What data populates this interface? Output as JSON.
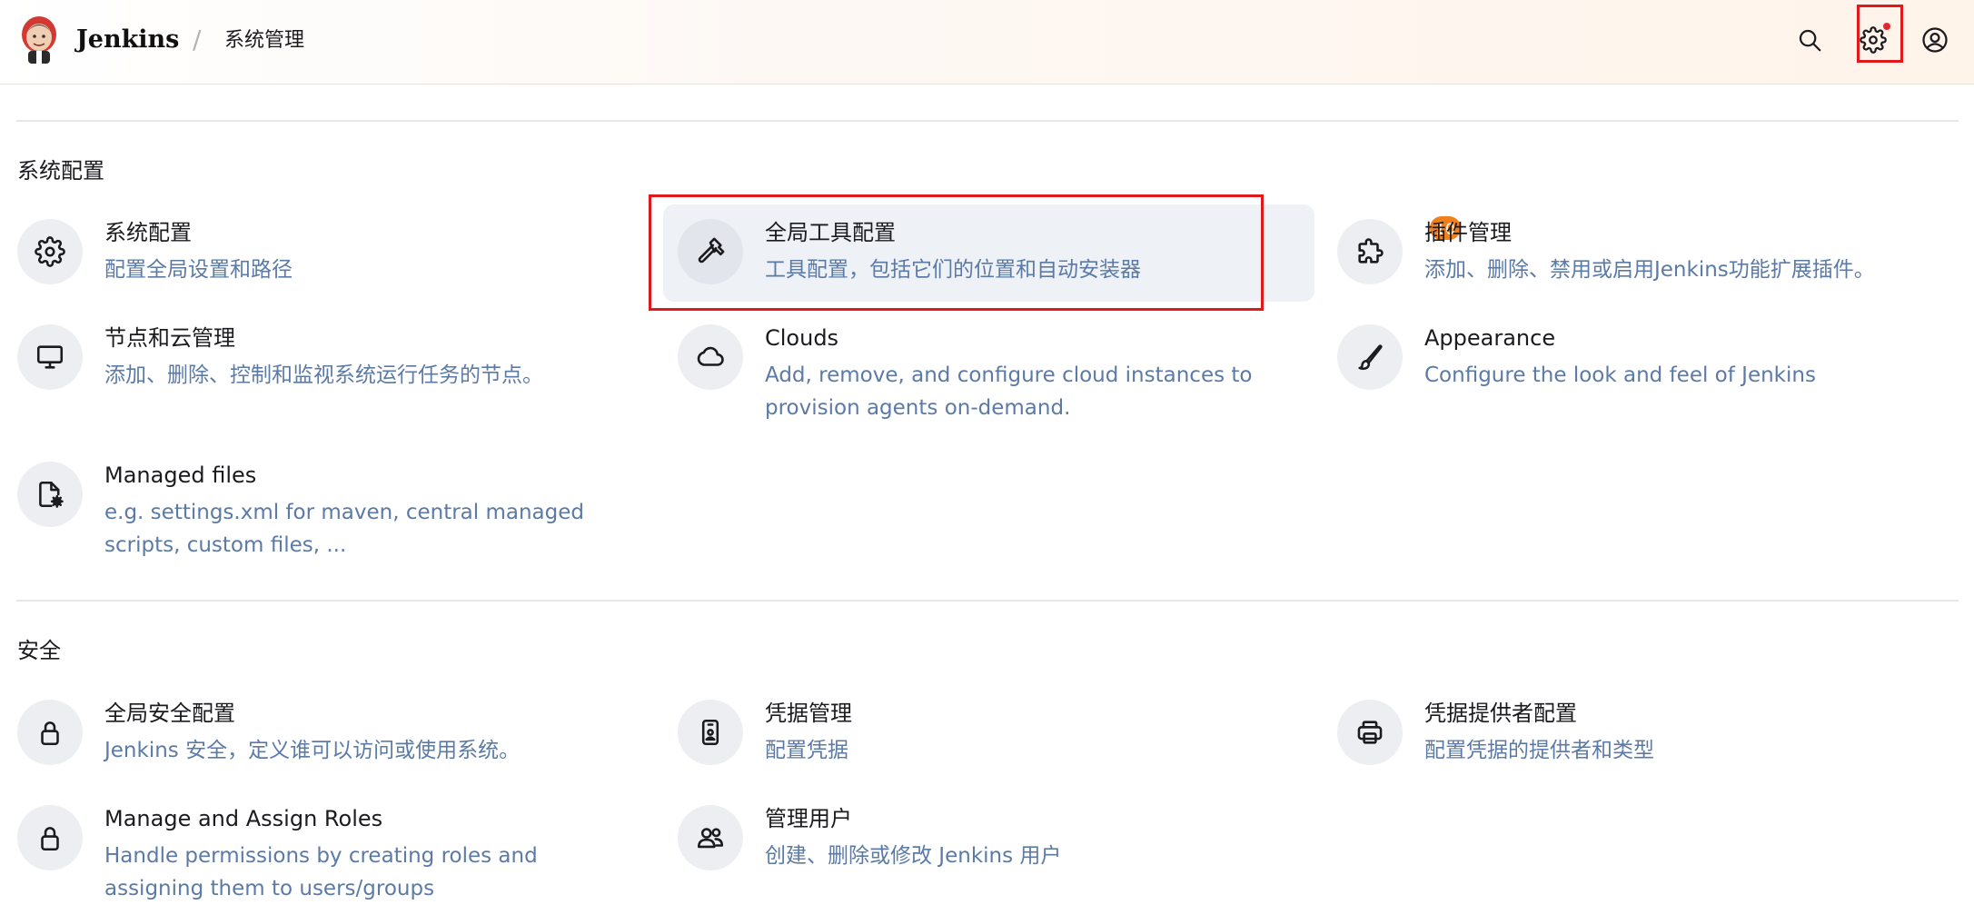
{
  "header": {
    "brand": "Jenkins",
    "separator": "/",
    "breadcrumb": "系统管理",
    "icons": [
      "search-icon",
      "gear-icon",
      "user-icon"
    ]
  },
  "sections": [
    {
      "title": "系统配置",
      "items": [
        {
          "title": "系统配置",
          "desc": "配置全局设置和路径",
          "icon": "gear-icon"
        },
        {
          "title": "全局工具配置",
          "desc": "工具配置，包括它们的位置和自动安装器",
          "icon": "hammer-icon",
          "highlighted": true
        },
        {
          "title": "插件管理",
          "desc": "添加、删除、禁用或启用Jenkins功能扩展插件。",
          "icon": "puzzle-icon",
          "badge": "10"
        },
        {
          "title": "节点和云管理",
          "desc": "添加、删除、控制和监视系统运行任务的节点。",
          "icon": "monitor-icon"
        },
        {
          "title": "Clouds",
          "desc": "Add, remove, and configure cloud instances to provision agents on-demand.",
          "icon": "cloud-icon"
        },
        {
          "title": "Appearance",
          "desc": "Configure the look and feel of Jenkins",
          "icon": "brush-icon"
        },
        {
          "title": "Managed files",
          "desc": "e.g. settings.xml for maven, central managed scripts, custom files, ...",
          "icon": "file-gear-icon"
        }
      ]
    },
    {
      "title": "安全",
      "items": [
        {
          "title": "全局安全配置",
          "desc": "Jenkins 安全，定义谁可以访问或使用系统。",
          "icon": "lock-icon"
        },
        {
          "title": "凭据管理",
          "desc": "配置凭据",
          "icon": "id-card-icon"
        },
        {
          "title": "凭据提供者配置",
          "desc": "配置凭据的提供者和类型",
          "icon": "credential-provider-icon"
        },
        {
          "title": "Manage and Assign Roles",
          "desc": "Handle permissions by creating roles and assigning them to users/groups",
          "icon": "lock-icon"
        },
        {
          "title": "管理用户",
          "desc": "创建、删除或修改 Jenkins 用户",
          "icon": "users-icon"
        }
      ]
    }
  ],
  "colors": {
    "accent_desc": "#5b7aa6",
    "highlight_border": "#e0191d",
    "badge": "#f0801c",
    "icon_circle": "#edeef2"
  }
}
